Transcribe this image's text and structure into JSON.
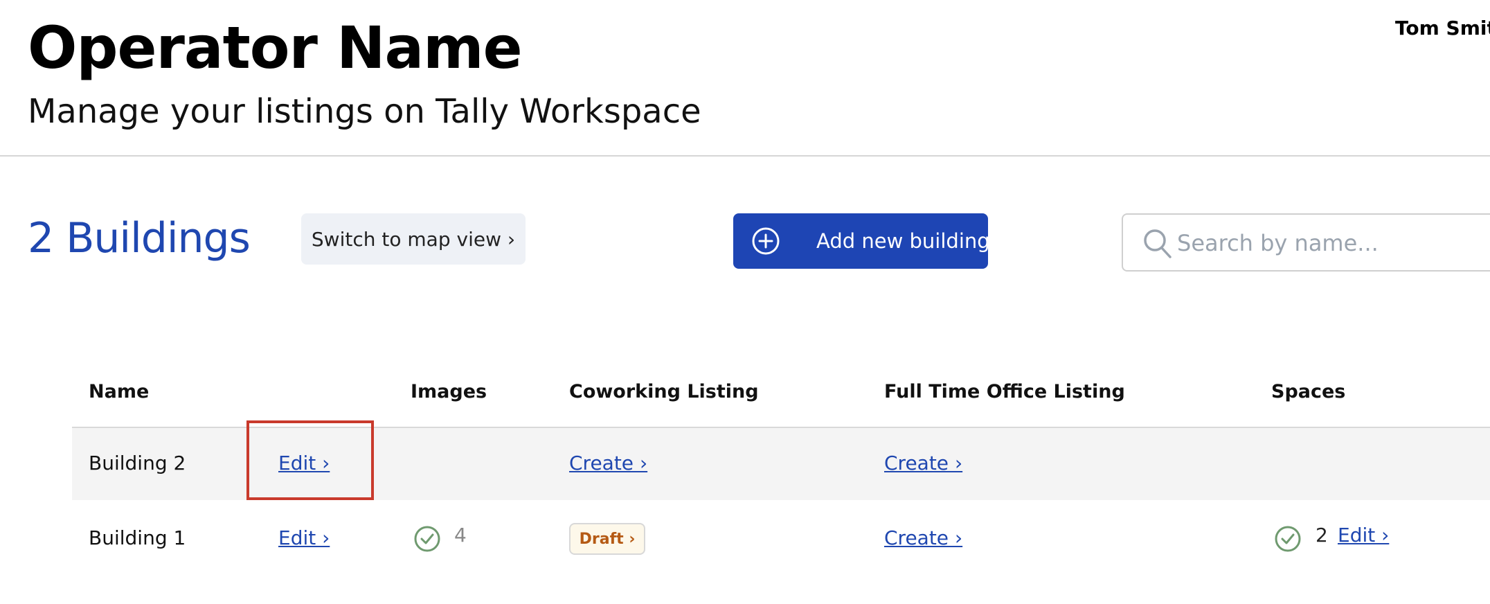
{
  "header": {
    "title": "Operator Name",
    "subtitle": "Manage your listings on Tally Workspace",
    "user_name": "Tom Smith"
  },
  "toolbar": {
    "building_count": "2 Buildings",
    "map_view_label": "Switch to map view ›",
    "add_building_label": "Add new building",
    "search_placeholder": "Search by name..."
  },
  "colors": {
    "accent": "#1e45b4",
    "link": "#1f47b0",
    "draft_text": "#b55a14",
    "check": "#6f9a6f",
    "highlight": "#c93a2c"
  },
  "table": {
    "columns": [
      "Name",
      "",
      "Images",
      "Coworking Listing",
      "Full Time Office Listing",
      "Spaces"
    ],
    "rows": [
      {
        "name": "Building 2",
        "edit": "Edit ›",
        "images": "",
        "coworking": "Create ›",
        "full_time": "Create ›",
        "spaces": "",
        "spaces_edit": ""
      },
      {
        "name": "Building 1",
        "edit": "Edit ›",
        "images": "4",
        "coworking": "Draft ›",
        "full_time": "Create ›",
        "spaces": "2",
        "spaces_edit": "Edit ›"
      }
    ]
  }
}
